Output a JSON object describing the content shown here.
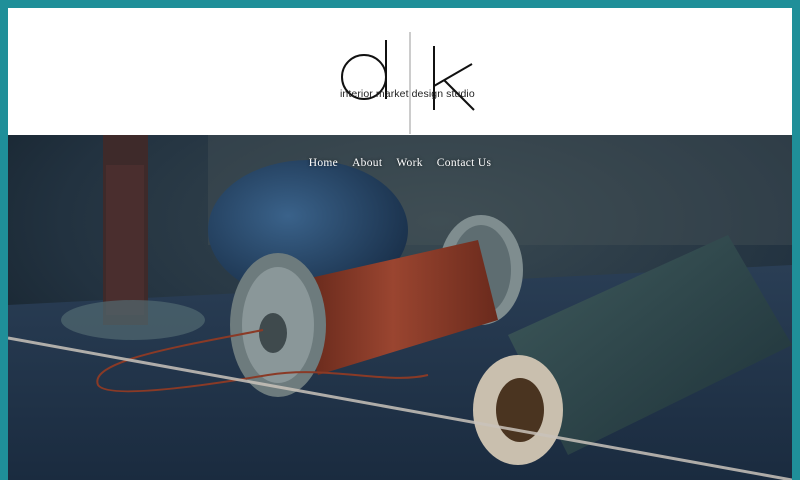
{
  "logo": {
    "letters": "d|k",
    "tagline": "interior market design studio"
  },
  "nav": {
    "items": [
      {
        "label": "Home"
      },
      {
        "label": "About"
      },
      {
        "label": "Work"
      },
      {
        "label": "Contact Us"
      }
    ]
  },
  "colors": {
    "frame": "#1f8f99",
    "header_bg": "#ffffff",
    "hero_dark": "#1b2a35",
    "thread_red": "#8a3a26",
    "thread_blue": "#24466b"
  },
  "hero": {
    "image": "thread-spools-photo"
  }
}
